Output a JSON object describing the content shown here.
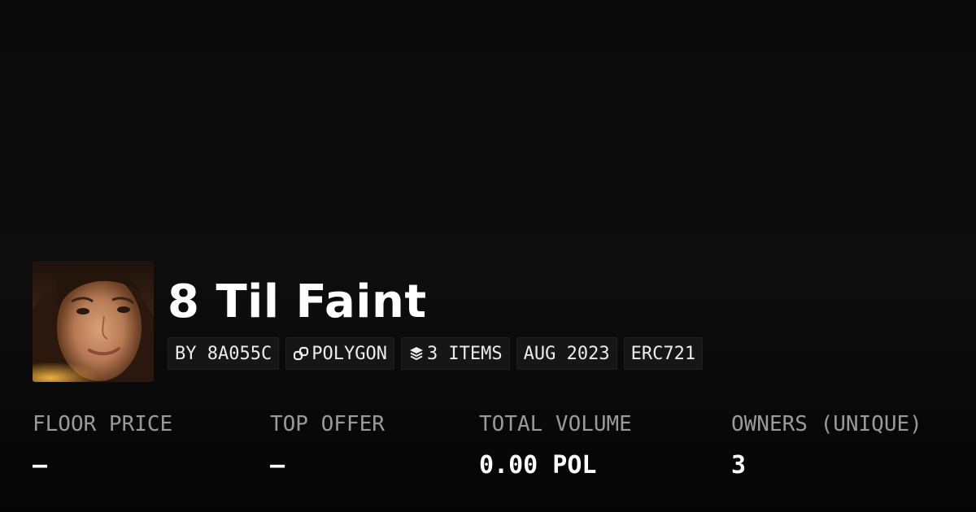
{
  "collection": {
    "title": "8 Til Faint",
    "avatar": "collection-avatar-portrait"
  },
  "badges": {
    "creator": "BY 8A055C",
    "chain": "POLYGON",
    "chain_icon": "polygon-link-icon",
    "items": "3 ITEMS",
    "items_icon": "layers-icon",
    "date": "AUG 2023",
    "standard": "ERC721"
  },
  "stats": {
    "floor_price": {
      "label": "FLOOR PRICE",
      "value": "–"
    },
    "top_offer": {
      "label": "TOP OFFER",
      "value": "–"
    },
    "total_volume": {
      "label": "TOTAL VOLUME",
      "value": "0.00 POL"
    },
    "owners": {
      "label": "OWNERS (UNIQUE)",
      "value": "3"
    }
  },
  "colors": {
    "background": "#0b0b0b",
    "badge_background": "#161616",
    "label_text": "#9a9a9a",
    "value_text": "#ffffff"
  }
}
